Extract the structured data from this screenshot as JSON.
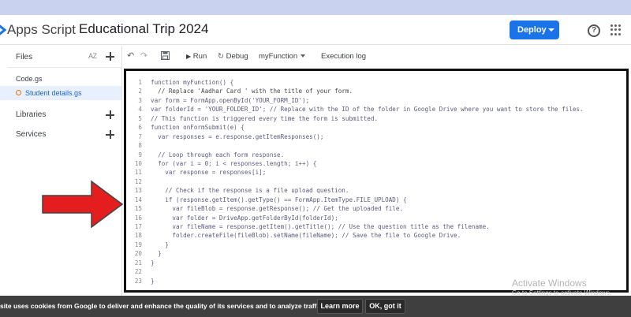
{
  "header": {
    "app_name": "Apps Script",
    "project_title": "Educational Trip 2024",
    "deploy_label": "Deploy",
    "help_icon": "help-circle-icon",
    "apps_icon": "google-apps-grid-icon"
  },
  "sidebar": {
    "files_label": "Files",
    "sort_label": "AZ",
    "files": [
      {
        "name": "Code.gs",
        "active": false,
        "unsaved": false
      },
      {
        "name": "Student details.gs",
        "active": true,
        "unsaved": true
      }
    ],
    "libraries_label": "Libraries",
    "services_label": "Services"
  },
  "toolbar": {
    "undo_icon": "undo-icon",
    "redo_icon": "redo-icon",
    "save_icon": "save-icon",
    "run_label": "Run",
    "debug_label": "Debug",
    "function_select": "myFunction",
    "execution_log_label": "Execution log"
  },
  "editor": {
    "lines": [
      {
        "no": "1",
        "text": "function myFunction() {"
      },
      {
        "no": "2",
        "text": "  // Replace 'Aadhar Card ' with the title of your form."
      },
      {
        "no": "3",
        "text": "var form = FormApp.openById('YOUR_FORM_ID');"
      },
      {
        "no": "4",
        "text": "var folderId = 'YOUR_FOLDER_ID'; // Replace with the ID of the folder in Google Drive where you want to store the files."
      },
      {
        "no": "5",
        "text": "// This function is triggered every time the form is submitted."
      },
      {
        "no": "6",
        "text": "function onFormSubmit(e) {"
      },
      {
        "no": "7",
        "text": "  var responses = e.response.getItemResponses();"
      },
      {
        "no": "8",
        "text": ""
      },
      {
        "no": "9",
        "text": "  // Loop through each form response."
      },
      {
        "no": "10",
        "text": "  for (var i = 0; i < responses.length; i++) {"
      },
      {
        "no": "11",
        "text": "    var response = responses[i];"
      },
      {
        "no": "12",
        "text": ""
      },
      {
        "no": "13",
        "text": "    // Check if the response is a file upload question."
      },
      {
        "no": "14",
        "text": "    if (response.getItem().getType() == FormApp.ItemType.FILE_UPLOAD) {"
      },
      {
        "no": "15",
        "text": "      var fileBlob = response.getResponse(); // Get the uploaded file."
      },
      {
        "no": "16",
        "text": "      var folder = DriveApp.getFolderById(folderId);"
      },
      {
        "no": "17",
        "text": "      var fileName = response.getItem().getTitle(); // Use the question title as the filename."
      },
      {
        "no": "18",
        "text": "      folder.createFile(fileBlob).setName(fileName); // Save the file to Google Drive."
      },
      {
        "no": "19",
        "text": "    }"
      },
      {
        "no": "20",
        "text": "  }"
      },
      {
        "no": "21",
        "text": "}"
      },
      {
        "no": "22",
        "text": ""
      },
      {
        "no": "23",
        "text": "}"
      }
    ]
  },
  "watermark": {
    "title": "Activate Windows",
    "subtitle": "Go to Settings to activate Windows."
  },
  "cookie_bar": {
    "text": "site uses cookies from Google to deliver and enhance the quality of its services and to analyze traffic.",
    "learn_more": "Learn more",
    "ok": "OK, got it"
  },
  "colors": {
    "deploy": "#1a73e8",
    "active_file_bg": "#e8f0fe",
    "arrow": "#e41e1e",
    "top_strip": "#c9d3f0",
    "cookie_bar": "#3f3f3f"
  }
}
